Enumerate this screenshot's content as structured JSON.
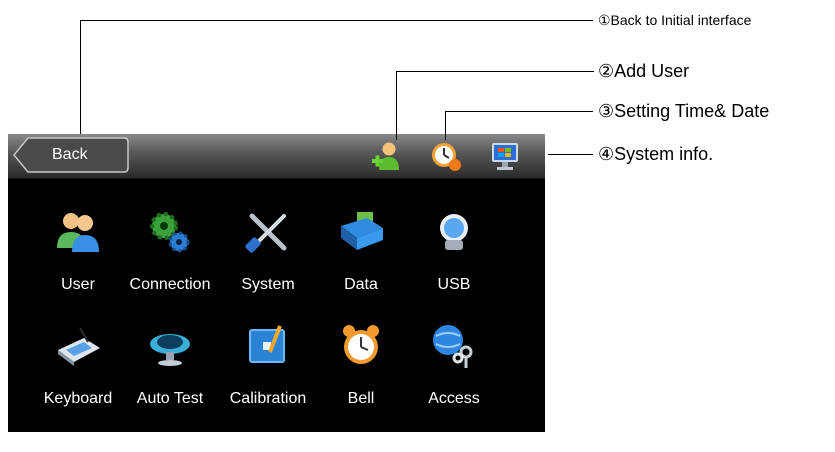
{
  "topbar": {
    "back_label": "Back"
  },
  "menu": [
    {
      "label": "User",
      "icon": "users-icon"
    },
    {
      "label": "Connection",
      "icon": "gears-icon"
    },
    {
      "label": "System",
      "icon": "tools-icon"
    },
    {
      "label": "Data",
      "icon": "database-folder-icon"
    },
    {
      "label": "USB",
      "icon": "usb-drive-icon"
    },
    {
      "label": "Keyboard",
      "icon": "keyboard-icon"
    },
    {
      "label": "Auto Test",
      "icon": "auto-test-icon"
    },
    {
      "label": "Calibration",
      "icon": "calibration-icon"
    },
    {
      "label": "Bell",
      "icon": "alarm-clock-icon"
    },
    {
      "label": "Access",
      "icon": "globe-keys-icon"
    }
  ],
  "callouts": [
    {
      "text": "①Back to Initial interface"
    },
    {
      "text": "②Add User"
    },
    {
      "text": "③Setting Time& Date"
    },
    {
      "text": "④System info."
    }
  ],
  "colors": {
    "screen_bg": "#000000",
    "bar_dark": "#2a2a2a",
    "text": "#ffffff"
  }
}
